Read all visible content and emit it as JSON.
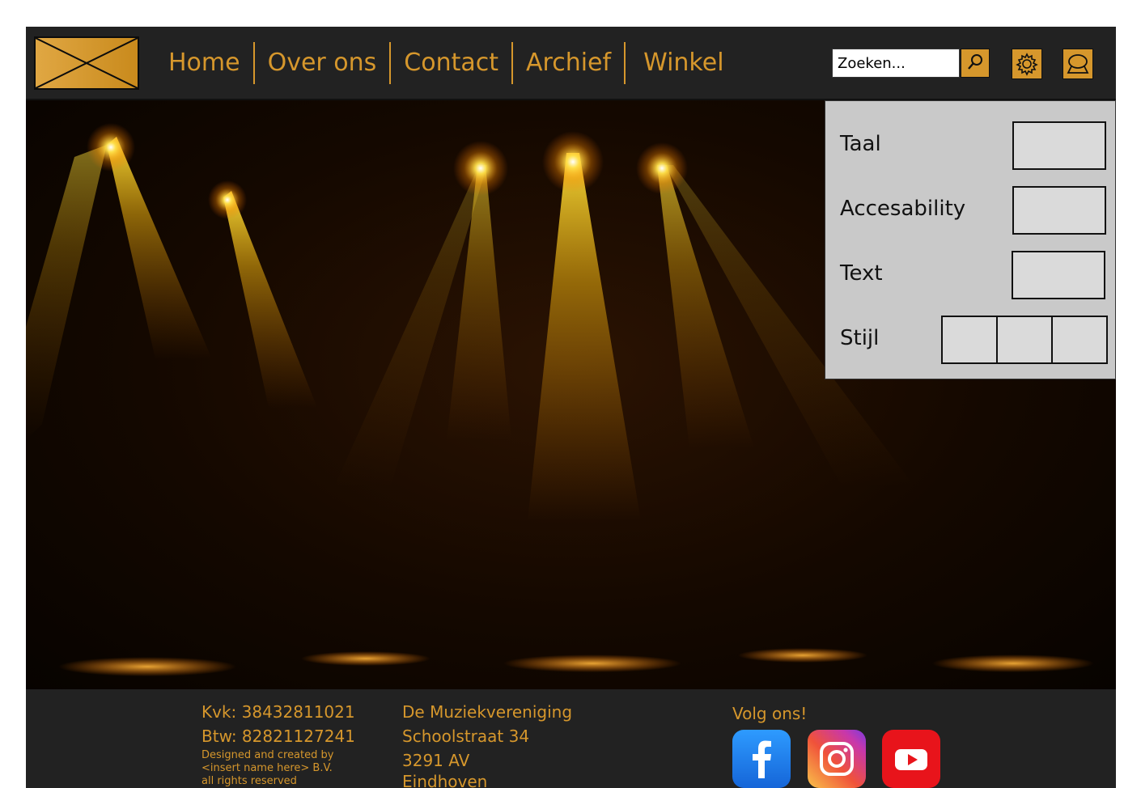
{
  "nav": {
    "items": [
      "Home",
      "Over ons",
      "Contact",
      "Archief",
      "Winkel"
    ]
  },
  "search": {
    "placeholder": "Zoeken..."
  },
  "settings": {
    "taal": "Taal",
    "accessibility": "Accesability",
    "text": "Text",
    "stijl": "Stijl"
  },
  "footer": {
    "kvk": "Kvk: 38432811021",
    "btw": "Btw: 82821127241",
    "credit_line1": "Designed and created by",
    "credit_line2": "<insert name here> B.V.",
    "credit_line3": "all rights reserved",
    "org_name": "De Muziekvereniging",
    "street": "Schoolstraat 34",
    "postcode": "3291 AV",
    "city": "Eindhoven",
    "follow": "Volg ons!"
  },
  "colors": {
    "accent": "#d6972c",
    "background": "#222222",
    "panel": "#c9c9c9"
  },
  "icons": [
    "search-icon",
    "settings-gear-icon",
    "chat-icon",
    "facebook-icon",
    "instagram-icon",
    "youtube-icon"
  ]
}
